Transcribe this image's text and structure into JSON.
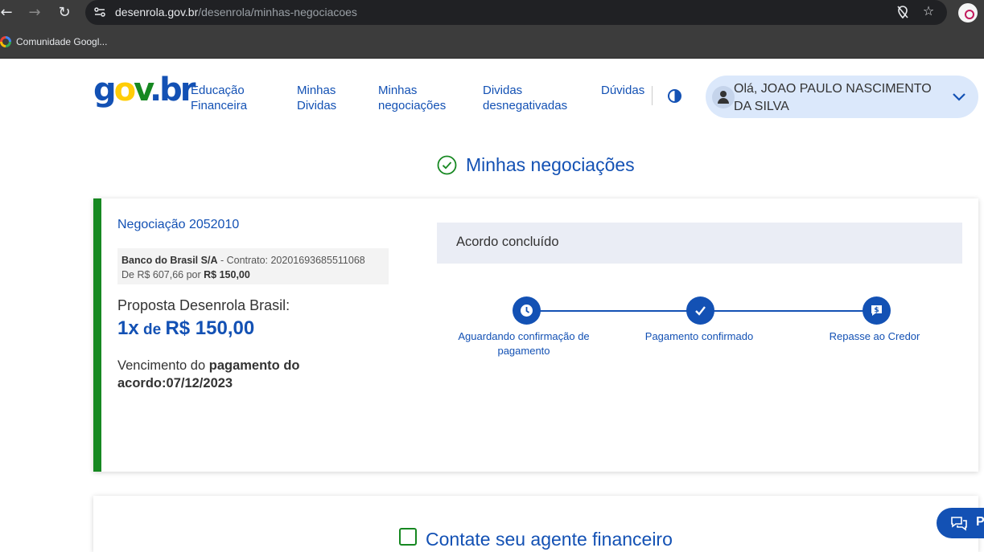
{
  "browser": {
    "back_icon": "←",
    "forward_icon": "→",
    "reload_icon": "↻",
    "url_host": "desenrola.gov.br",
    "url_path": "/desenrola/minhas-negociacoes",
    "star_icon": "☆",
    "bookmark_label": "Comunidade Googl..."
  },
  "header": {
    "logo": {
      "g": "g",
      "o": "o",
      "v": "v",
      "dot": ".",
      "b": "b",
      "r": "r"
    },
    "nav": {
      "educacao_1": "Educação",
      "educacao_2": "Financeira",
      "minhas_dividas_1": "Minhas",
      "minhas_dividas_2": "Dividas",
      "minhas_negociacoes_1": "Minhas",
      "minhas_negociacoes_2": "negociações",
      "desnegativadas_1": "Dividas",
      "desnegativadas_2": "desnegativadas",
      "duvidas": "Dúvidas"
    },
    "user": {
      "greeting_line1": "Olá, JOAO PAULO NASCIMENTO",
      "greeting_line2": "DA SILVA"
    }
  },
  "main": {
    "title": "Minhas negociações",
    "negotiation": {
      "title": "Negociação 2052010",
      "bank": "Banco do Brasil S/A",
      "contract_text": " - Contrato: 20201693685511068",
      "from_text": "De R$ 607,66 por ",
      "to_value": "R$ 150,00",
      "proposal_label": "Proposta Desenrola Brasil:",
      "proposal_count": "1x",
      "proposal_de": " de ",
      "proposal_value": "R$ 150,00",
      "due_prefix": "Vencimento do ",
      "due_bold": "pagamento do acordo:",
      "due_date": "07/12/2023",
      "status": "Acordo concluído",
      "steps": [
        {
          "label": "Aguardando confirmação de pagamento",
          "icon": "clock-icon"
        },
        {
          "label": "Pagamento confirmado",
          "icon": "check-icon"
        },
        {
          "label": "Repasse ao Credor",
          "icon": "money-chat-icon"
        }
      ]
    },
    "contact": {
      "title": "Contate seu agente financeiro"
    },
    "chat": {
      "label": "P"
    }
  },
  "colors": {
    "primary": "#1351b4",
    "success": "#168821",
    "status_bg": "#eaedf5",
    "user_pill": "#dbe8fb"
  }
}
